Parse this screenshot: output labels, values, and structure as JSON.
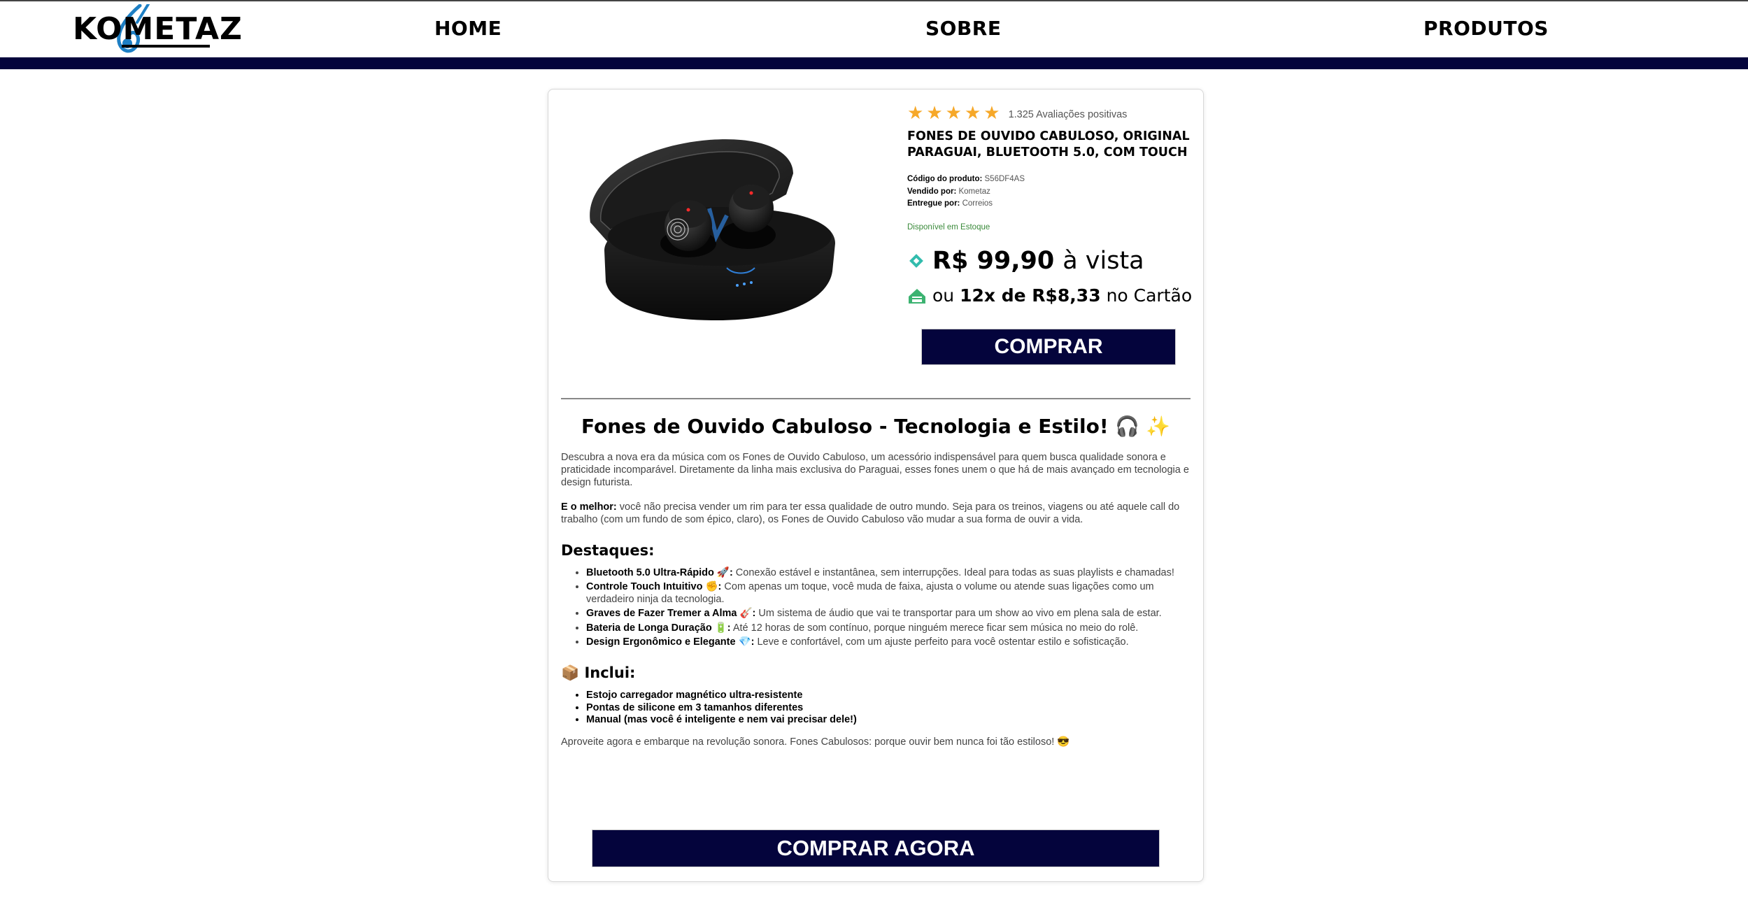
{
  "header": {
    "logo_text": "KOMETAZ",
    "nav": {
      "home": "HOME",
      "about": "SOBRE",
      "products": "PRODUTOS"
    },
    "accent_color": "#04043c",
    "logo_mark_color": "#1d7fc4"
  },
  "product": {
    "rating": {
      "stars": 5,
      "text": "1.325 Avaliações positivas",
      "star_color": "#f6a829"
    },
    "title": "FONES DE OUVIDO CABULOSO, ORIGINAL PARAGUAI, BLUETOOTH 5.0, COM TOUCH",
    "meta": {
      "code_label": "Código do produto:",
      "code_value": "S56DF4AS",
      "seller_label": "Vendido por:",
      "seller_value": "Kometaz",
      "delivery_label": "Entregue por:",
      "delivery_value": "Correios"
    },
    "stock": "Disponível em Estoque",
    "price": {
      "value": "R$ 99,90",
      "suffix": "à vista",
      "pix_icon": "pix-icon",
      "pix_color": "#32bcad"
    },
    "installments": {
      "prefix": "ou",
      "value": "12x de R$8,33",
      "suffix": "no Cartão",
      "icon": "credit-card-icon",
      "icon_color": "#3cb371"
    },
    "buy_button": "COMPRAR",
    "image_alt": "earbuds-product-image"
  },
  "description": {
    "title": "Fones de Ouvido Cabuloso - Tecnologia e Estilo!",
    "title_emoji": "🎧 ✨",
    "intro": "Descubra a nova era da música com os Fones de Ouvido Cabuloso, um acessório indispensável para quem busca qualidade sonora e praticidade incomparável. Diretamente da linha mais exclusiva do Paraguai, esses fones unem o que há de mais avançado em tecnologia e design futurista.",
    "best_label": "E o melhor:",
    "best_text": " você não precisa vender um rim para ter essa qualidade de outro mundo. Seja para os treinos, viagens ou até aquele call do trabalho (com um fundo de som épico, claro), os Fones de Ouvido Cabuloso vão mudar a sua forma de ouvir a vida.",
    "highlights_title": "Destaques:",
    "highlights": [
      {
        "label": "Bluetooth 5.0 Ultra-Rápido 🚀:",
        "text": " Conexão estável e instantânea, sem interrupções. Ideal para todas as suas playlists e chamadas!"
      },
      {
        "label": "Controle Touch Intuitivo ✊:",
        "text": " Com apenas um toque, você muda de faixa, ajusta o volume ou atende suas ligações como um verdadeiro ninja da tecnologia."
      },
      {
        "label": "Graves de Fazer Tremer a Alma 🎸:",
        "text": " Um sistema de áudio que vai te transportar para um show ao vivo em plena sala de estar."
      },
      {
        "label": "Bateria de Longa Duração 🔋:",
        "text": " Até 12 horas de som contínuo, porque ninguém merece ficar sem música no meio do rolê."
      },
      {
        "label": "Design Ergonômico e Elegante 💎:",
        "text": " Leve e confortável, com um ajuste perfeito para você ostentar estilo e sofisticação."
      }
    ],
    "includes_title": "📦 Inclui:",
    "includes": [
      "Estojo carregador magnético ultra-resistente",
      "Pontas de silicone em 3 tamanhos diferentes",
      "Manual (mas você é inteligente e nem vai precisar dele!)"
    ],
    "closing": "Aproveite agora e embarque na revolução sonora. Fones Cabulosos: porque ouvir bem nunca foi tão estiloso! 😎",
    "buy_now_button": "COMPRAR AGORA"
  }
}
